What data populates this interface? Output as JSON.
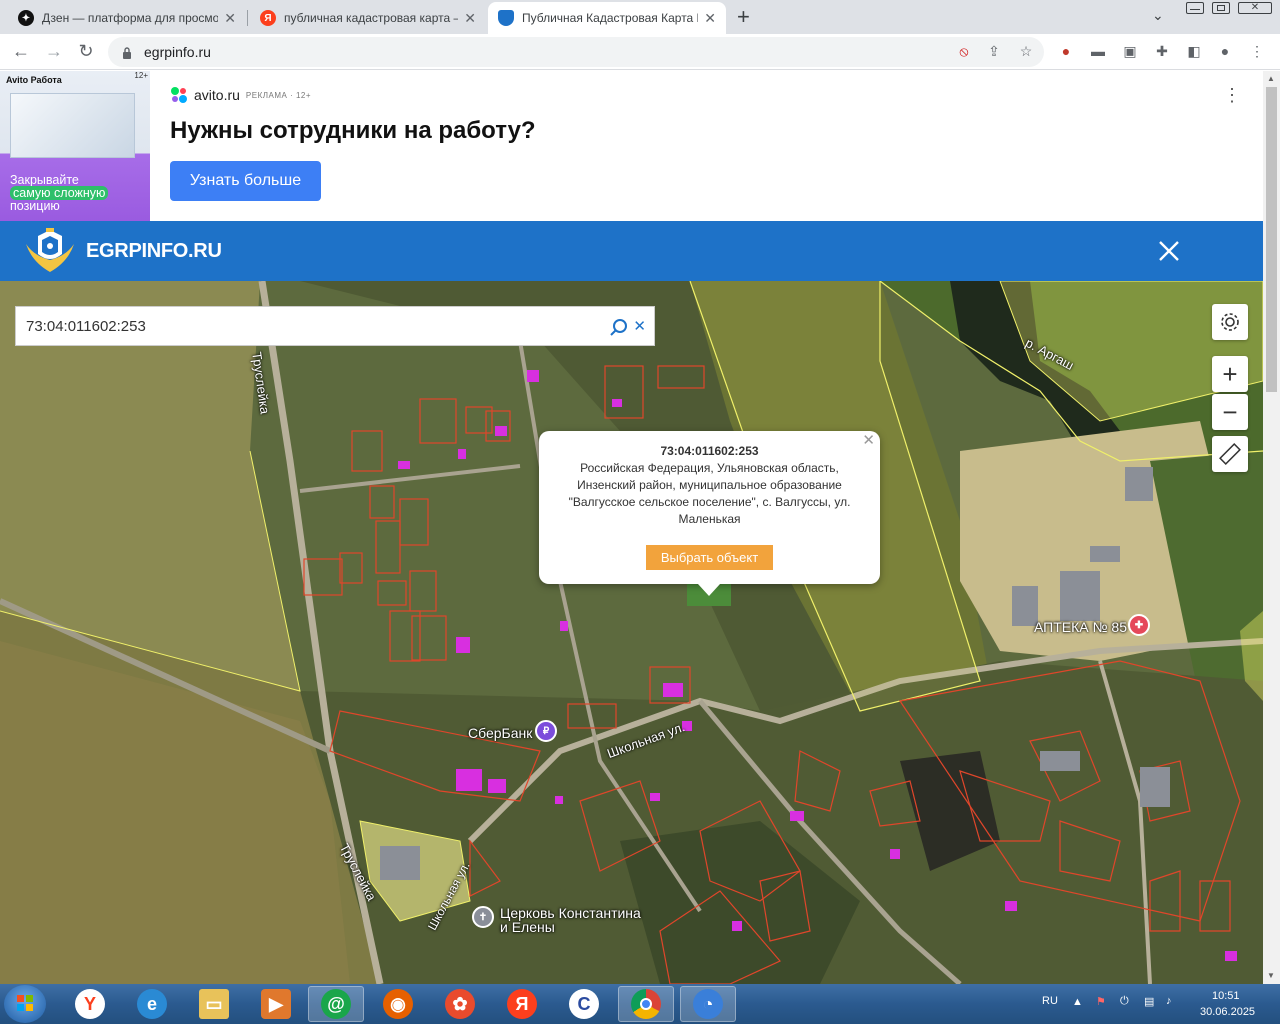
{
  "browser": {
    "tabs": [
      {
        "title": "Дзен — платформа для просмотра",
        "icon": "dzen-icon",
        "active": false
      },
      {
        "title": "публичная кадастровая карта —",
        "icon": "yandex-icon",
        "active": false
      },
      {
        "title": "Публичная Кадастровая Карта Р",
        "icon": "shield-icon",
        "active": true
      }
    ],
    "url": "egrpinfo.ru"
  },
  "ad": {
    "image_brand": "Avito Работа",
    "image_age": "12+",
    "image_caption_1": "Закрывайте",
    "image_caption_2": "самую сложную",
    "image_caption_3": "позицию",
    "site": "avito.ru",
    "site_note": "РЕКЛАМА · 12+",
    "headline": "Нужны сотрудники на работу?",
    "button": "Узнать больше"
  },
  "site": {
    "name": "EGRPINFO.RU"
  },
  "map": {
    "search_value": "73:04:011602:253",
    "popup": {
      "number": "73:04:011602:253",
      "address": "Российская Федерация, Ульяновская область, Инзенский район, муниципальное образование \"Валгусское сельское поселение\", с. Валгуссы, ул. Маленькая",
      "button": "Выбрать объект"
    },
    "labels": {
      "street_1": "Труслейка",
      "street_2": "Труслейка",
      "street_3": "Школьная ул.",
      "street_4": "Школьная ул.",
      "river": "р. Аргаш",
      "pharmacy": "АПТЕКА № 85",
      "bank": "СберБанк",
      "church": "Церковь Константина и Елены"
    }
  },
  "taskbar": {
    "lang": "RU",
    "time": "10:51",
    "date": "30.06.2025"
  },
  "colors": {
    "header_blue": "#1e72c8",
    "popup_button": "#f2a33c",
    "parcel_outline": "#e0462a",
    "zone_yellow": "#f0f06a"
  }
}
